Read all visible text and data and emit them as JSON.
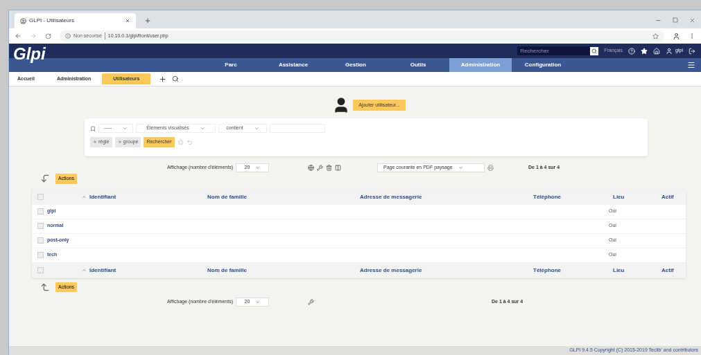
{
  "browser": {
    "tab_title": "GLPI - Utilisateurs",
    "security": "Non sécurisé",
    "url": "10.10.0.1/glpi/front/user.php"
  },
  "header": {
    "logo": "Glpi",
    "search_placeholder": "Rechercher",
    "language": "Français",
    "user": "glpi"
  },
  "menu": [
    {
      "label": "Parc",
      "selected": false
    },
    {
      "label": "Assistance",
      "selected": false
    },
    {
      "label": "Gestion",
      "selected": false
    },
    {
      "label": "Outils",
      "selected": false
    },
    {
      "label": "Administration",
      "selected": true
    },
    {
      "label": "Configuration",
      "selected": false
    }
  ],
  "breadcrumb": [
    "Accueil",
    "Administration",
    "Utilisateurs"
  ],
  "add_button": "Ajouter utilisateur...",
  "search": {
    "criteria": [
      "-----",
      "Éléments visualisés",
      "contient"
    ],
    "buttons": [
      "règle",
      "groupe"
    ],
    "submit": "Rechercher"
  },
  "pager_top": {
    "label": "Affichage (nombre d'éléments)",
    "per_page": "20",
    "export": "Page courante en PDF paysage",
    "range": "De 1 à 4 sur 4"
  },
  "actions_top": "Actions",
  "table": {
    "header_checked": false,
    "columns": [
      "Identifiant",
      "Nom de famille",
      "Adresse de messagerie",
      "Téléphone",
      "Lieu",
      "Actif"
    ],
    "rows": [
      {
        "checked": false,
        "login": "glpi",
        "active": "Oui"
      },
      {
        "checked": false,
        "login": "normal",
        "active": "Oui"
      },
      {
        "checked": false,
        "login": "post-only",
        "active": "Oui"
      },
      {
        "checked": false,
        "login": "tech",
        "active": "Oui"
      }
    ],
    "footer_checked": false,
    "footer_columns": [
      "Identifiant",
      "Nom de famille",
      "Adresse de messagerie",
      "Téléphone",
      "Lieu",
      "Actif"
    ]
  },
  "actions_bottom": "Actions",
  "pager_bottom": {
    "label": "Affichage (nombre d'éléments)",
    "per_page": "20",
    "range": "De 1 à 4 sur 4"
  },
  "footer": "GLPI 9.4.5 Copyright (C) 2015-2019 Teclib' and contributors"
}
